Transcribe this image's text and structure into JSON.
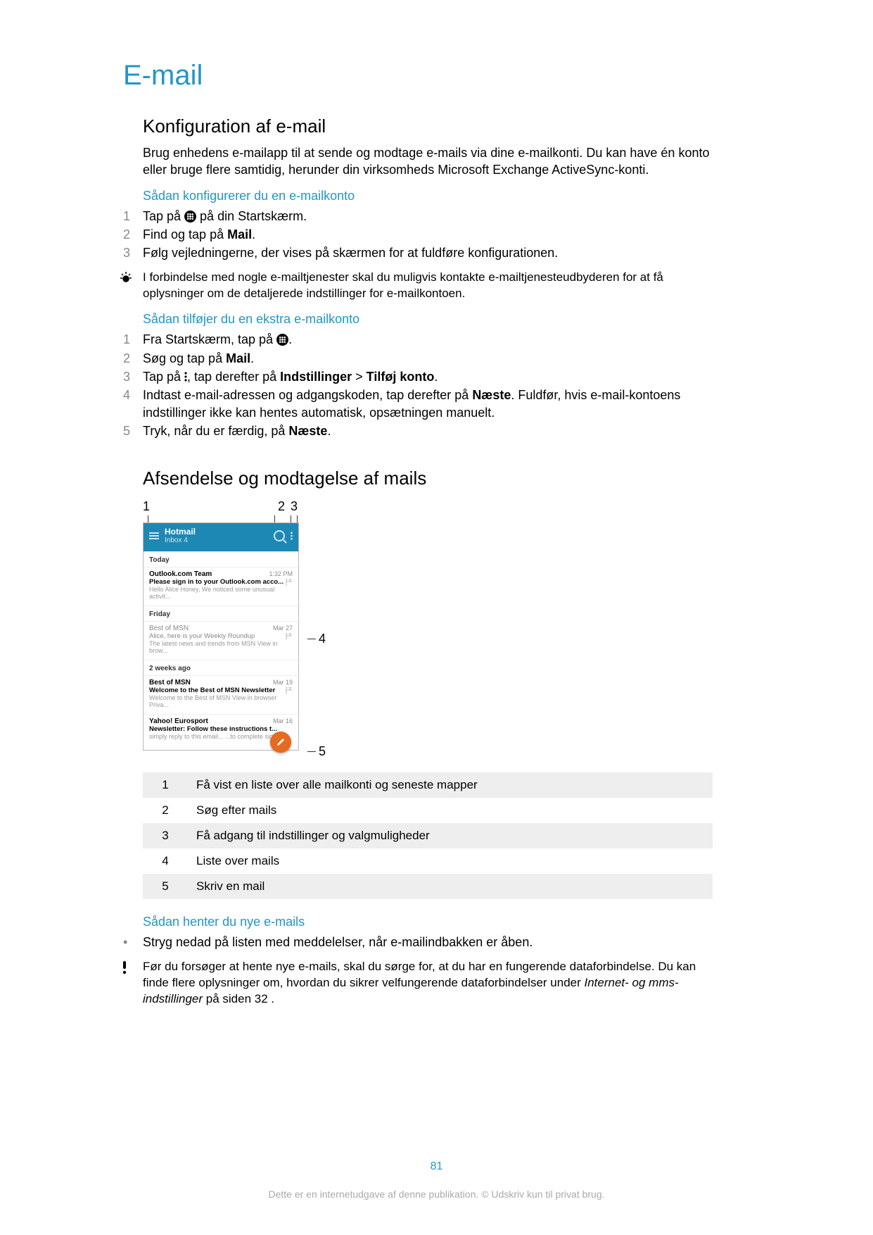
{
  "title": "E-mail",
  "section1": {
    "heading": "Konfiguration af e-mail",
    "intro": "Brug enhedens e-mailapp til at sende og modtage e-mails via dine e-mailkonti. Du kan have én konto eller bruge flere samtidig, herunder din virksomheds Microsoft Exchange ActiveSync-konti.",
    "sub1": "Sådan konfigurerer du en e-mailkonto",
    "steps1": {
      "n1": "1",
      "t1a": "Tap på ",
      "t1b": " på din Startskærm.",
      "n2": "2",
      "t2a": "Find og tap på ",
      "t2b": "Mail",
      "t2c": ".",
      "n3": "3",
      "t3": "Følg vejledningerne, der vises på skærmen for at fuldføre konfigurationen."
    },
    "note1": "I forbindelse med nogle e-mailtjenester skal du muligvis kontakte e-mailtjenesteudbyderen for at få oplysninger om de detaljerede indstillinger for e-mailkontoen.",
    "sub2": "Sådan tilføjer du en ekstra e-mailkonto",
    "steps2": {
      "n1": "1",
      "t1a": "Fra Startskærm, tap på ",
      "t1b": ".",
      "n2": "2",
      "t2a": "Søg og tap på ",
      "t2b": "Mail",
      "t2c": ".",
      "n3": "3",
      "t3a": "Tap på ",
      "t3b": ", tap derefter på ",
      "t3c": "Indstillinger",
      "t3d": " > ",
      "t3e": "Tilføj konto",
      "t3f": ".",
      "n4": "4",
      "t4a": "Indtast e-mail-adressen og adgangskoden, tap derefter på ",
      "t4b": "Næste",
      "t4c": ". Fuldfør, hvis e-mail-kontoens indstillinger ikke kan hentes automatisk, opsætningen manuelt.",
      "n5": "5",
      "t5a": "Tryk, når du er færdig, på ",
      "t5b": "Næste",
      "t5c": "."
    }
  },
  "section2": {
    "heading": "Afsendelse og modtagelse af mails",
    "callouts": {
      "c1": "1",
      "c2": "2",
      "c3": "3",
      "c4": "4",
      "c5": "5"
    },
    "phone": {
      "account": "Hotmail",
      "inbox": "Inbox 4",
      "groups": {
        "g1": "Today",
        "g2": "Friday",
        "g3": "2 weeks ago"
      },
      "items": [
        {
          "from": "Outlook.com Team",
          "time": "1:32 PM",
          "subj": "Please sign in to your Outlook.com acco...",
          "prev": "Hello Alice Honey, We noticed some unusual activit..."
        },
        {
          "from": "Best of MSN",
          "time": "Mar 27",
          "subj": "Alice, here is your Weekly Roundup",
          "prev": "The latest news and trends from MSN View in brow..."
        },
        {
          "from": "Best of MSN",
          "time": "Mar 19",
          "subj": "Welcome to the Best of MSN Newsletter",
          "prev": "Welcome to the Best of MSN View in browser Priva..."
        },
        {
          "from": "Yahoo! Eurosport",
          "time": "Mar 16",
          "subj": "Newsletter: Follow these instructions t...",
          "prev": "simply reply to this email... ...to complete sig..."
        }
      ]
    },
    "legend": [
      {
        "n": "1",
        "t": "Få vist en liste over alle mailkonti og seneste mapper"
      },
      {
        "n": "2",
        "t": "Søg efter mails"
      },
      {
        "n": "3",
        "t": "Få adgang til indstillinger og valgmuligheder"
      },
      {
        "n": "4",
        "t": "Liste over mails"
      },
      {
        "n": "5",
        "t": "Skriv en mail"
      }
    ],
    "sub": "Sådan henter du nye e-mails",
    "bullet": "Stryg nedad på listen med meddelelser, når e-mailindbakken er åben.",
    "warn_a": "Før du forsøger at hente nye e-mails, skal du sørge for, at du har en fungerende dataforbindelse. Du kan finde flere oplysninger om, hvordan du sikrer velfungerende dataforbindelser under ",
    "warn_b": "Internet- og mms-indstillinger",
    "warn_c": " på siden 32 ."
  },
  "page_number": "81",
  "footer": "Dette er en internetudgave af denne publikation. © Udskriv kun til privat brug."
}
